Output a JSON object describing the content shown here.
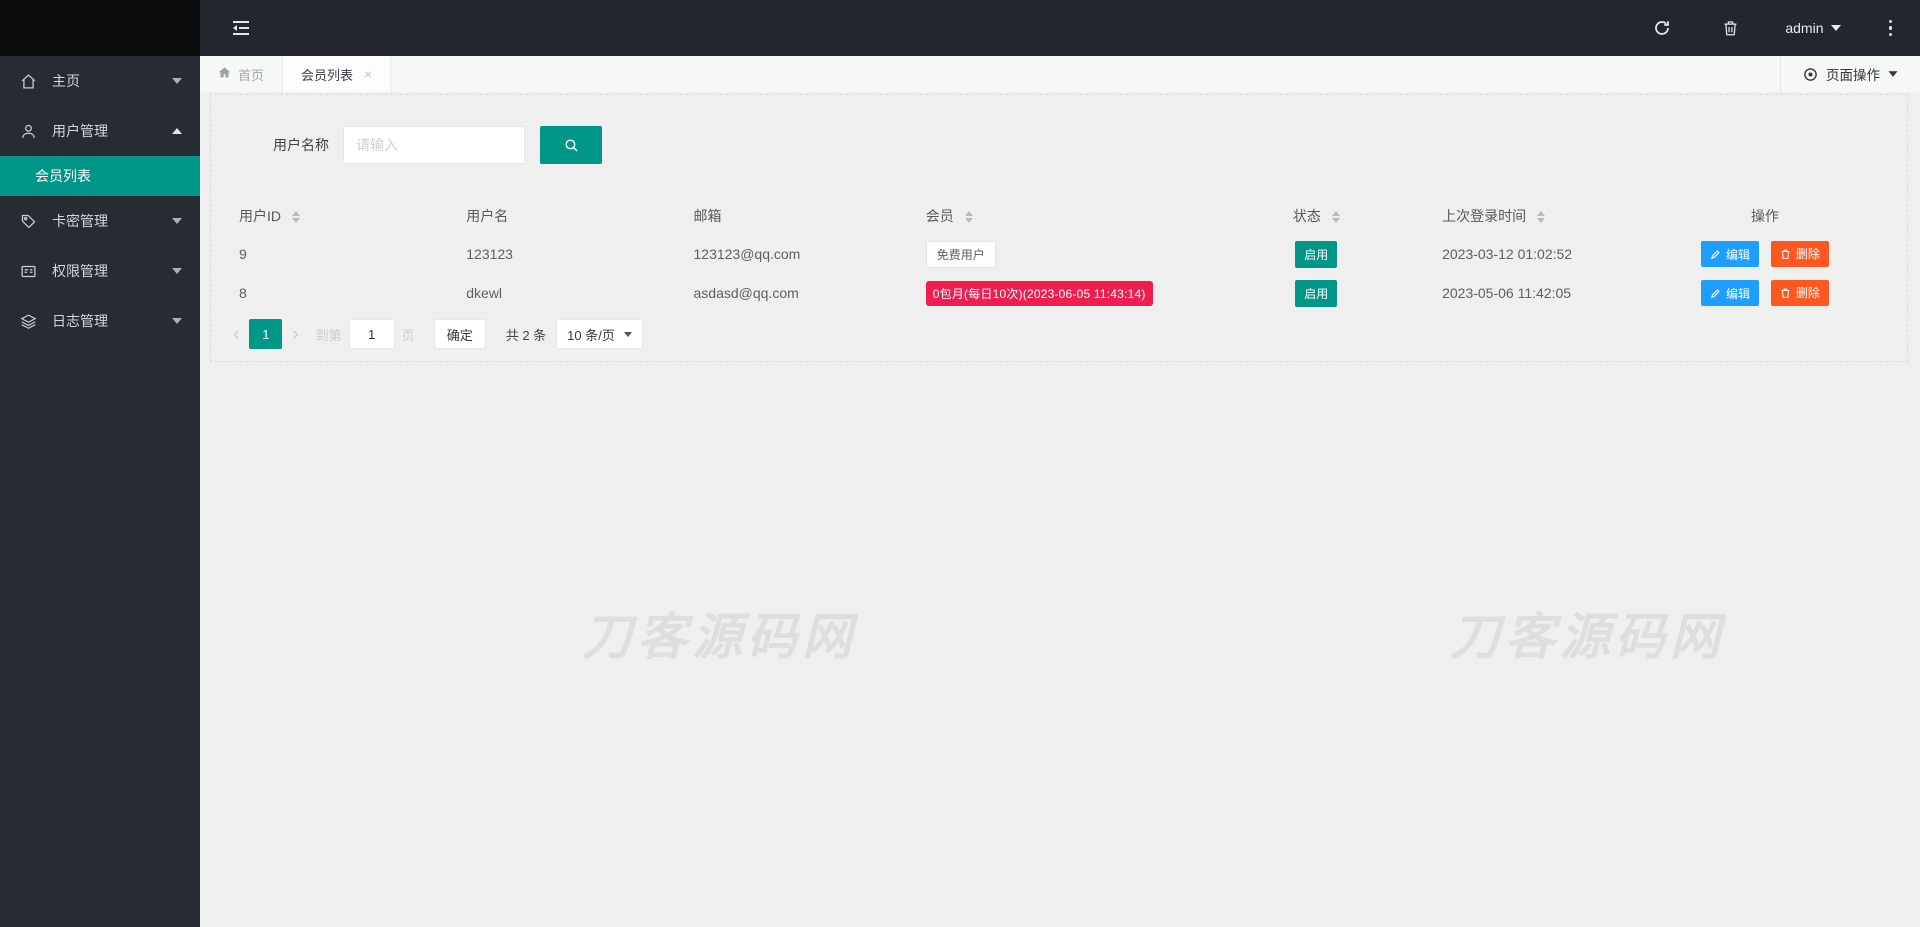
{
  "colors": {
    "accent": "#009688",
    "edit_button": "#1E9FFF",
    "delete_button": "#FF5722",
    "member_paid_badge": "#EE1E50",
    "navbar_bg": "#23262D",
    "sidebar_bg": "#272B34"
  },
  "navbar": {
    "username": "admin"
  },
  "sidebar": {
    "items": [
      {
        "label": "主页",
        "icon": "home-icon"
      },
      {
        "label": "用户管理",
        "icon": "user-icon",
        "expanded": true,
        "children": [
          {
            "label": "会员列表",
            "active": true
          }
        ]
      },
      {
        "label": "卡密管理",
        "icon": "tag-icon"
      },
      {
        "label": "权限管理",
        "icon": "permission-icon"
      },
      {
        "label": "日志管理",
        "icon": "log-icon"
      }
    ]
  },
  "tabbar": {
    "tabs": [
      {
        "label": "首页",
        "icon": "home-icon"
      },
      {
        "label": "会员列表",
        "active": true,
        "close_glyph": "×"
      }
    ],
    "page_actions_label": "页面操作"
  },
  "search": {
    "label": "用户名称",
    "placeholder": "请输入"
  },
  "table": {
    "columns": [
      {
        "label": "用户ID",
        "sortable": true
      },
      {
        "label": "用户名",
        "sortable": false
      },
      {
        "label": "邮箱",
        "sortable": false
      },
      {
        "label": "会员",
        "sortable": true
      },
      {
        "label": "状态",
        "sortable": true
      },
      {
        "label": "上次登录时间",
        "sortable": true
      },
      {
        "label": "操作",
        "sortable": false
      }
    ],
    "rows": [
      {
        "id": "9",
        "username": "123123",
        "email": "123123@qq.com",
        "member": "免费用户",
        "member_type": "free",
        "status": "启用",
        "last_login": "2023-03-12 01:02:52"
      },
      {
        "id": "8",
        "username": "dkewl",
        "email": "asdasd@qq.com",
        "member": "0包月(每日10次)(2023-06-05 11:43:14)",
        "member_type": "paid",
        "status": "启用",
        "last_login": "2023-05-06 11:42:05"
      }
    ],
    "actions": {
      "edit": "编辑",
      "delete": "删除"
    }
  },
  "pagination": {
    "prev_glyph": "‹",
    "next_glyph": "›",
    "current_page": "1",
    "jump_prefix": "到第",
    "jump_value": "1",
    "jump_suffix": "页",
    "confirm_label": "确定",
    "total_label": "共 2 条",
    "page_size_label": "10 条/页"
  },
  "watermark": {
    "text": "刀客源码网"
  }
}
